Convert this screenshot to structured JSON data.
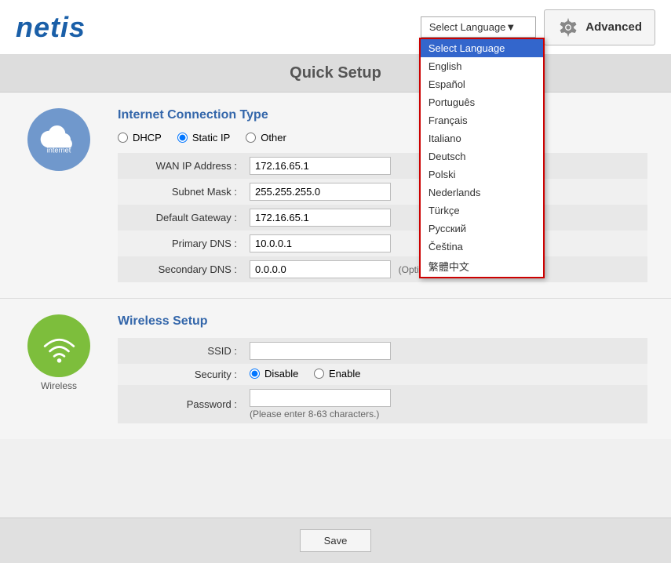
{
  "header": {
    "logo": "netis",
    "advanced_label": "Advanced",
    "language_select_label": "Select Language",
    "language_dropdown": {
      "items": [
        {
          "value": "select",
          "label": "Select Language",
          "selected": true
        },
        {
          "value": "en",
          "label": "English",
          "selected": false
        },
        {
          "value": "es",
          "label": "Español",
          "selected": false
        },
        {
          "value": "pt",
          "label": "Português",
          "selected": false
        },
        {
          "value": "fr",
          "label": "Français",
          "selected": false
        },
        {
          "value": "it",
          "label": "Italiano",
          "selected": false
        },
        {
          "value": "de",
          "label": "Deutsch",
          "selected": false
        },
        {
          "value": "pl",
          "label": "Polski",
          "selected": false
        },
        {
          "value": "nl",
          "label": "Nederlands",
          "selected": false
        },
        {
          "value": "tr",
          "label": "Türkçe",
          "selected": false
        },
        {
          "value": "ru",
          "label": "Русский",
          "selected": false
        },
        {
          "value": "cs",
          "label": "Čeština",
          "selected": false
        },
        {
          "value": "zh",
          "label": "繁體中文",
          "selected": false
        }
      ]
    }
  },
  "page": {
    "title": "Quick S"
  },
  "internet_section": {
    "title": "Internet Connection Type",
    "icon_label": "internet",
    "connection_types": [
      {
        "label": "DHCP",
        "value": "dhcp"
      },
      {
        "label": "Static IP",
        "value": "static",
        "selected": true
      },
      {
        "label": "Other",
        "value": "other"
      }
    ],
    "fields": [
      {
        "label": "WAN IP Address :",
        "value": "172.16.65.1",
        "id": "wan_ip"
      },
      {
        "label": "Subnet Mask :",
        "value": "255.255.255.0",
        "id": "subnet"
      },
      {
        "label": "Default Gateway :",
        "value": "172.16.65.1",
        "id": "gateway"
      },
      {
        "label": "Primary DNS :",
        "value": "10.0.0.1",
        "id": "primary_dns"
      },
      {
        "label": "Secondary DNS :",
        "value": "0.0.0.0",
        "id": "secondary_dns",
        "optional": "(Optional)"
      }
    ]
  },
  "wireless_section": {
    "title": "Wireless Setup",
    "icon_label": "Wireless",
    "fields": {
      "ssid_label": "SSID :",
      "ssid_value": "",
      "security_label": "Security :",
      "security_options": [
        {
          "label": "Disable",
          "selected": true
        },
        {
          "label": "Enable",
          "selected": false
        }
      ],
      "password_label": "Password :",
      "password_hint": "(Please enter 8-63 characters.)"
    }
  },
  "footer": {
    "save_label": "Save"
  }
}
